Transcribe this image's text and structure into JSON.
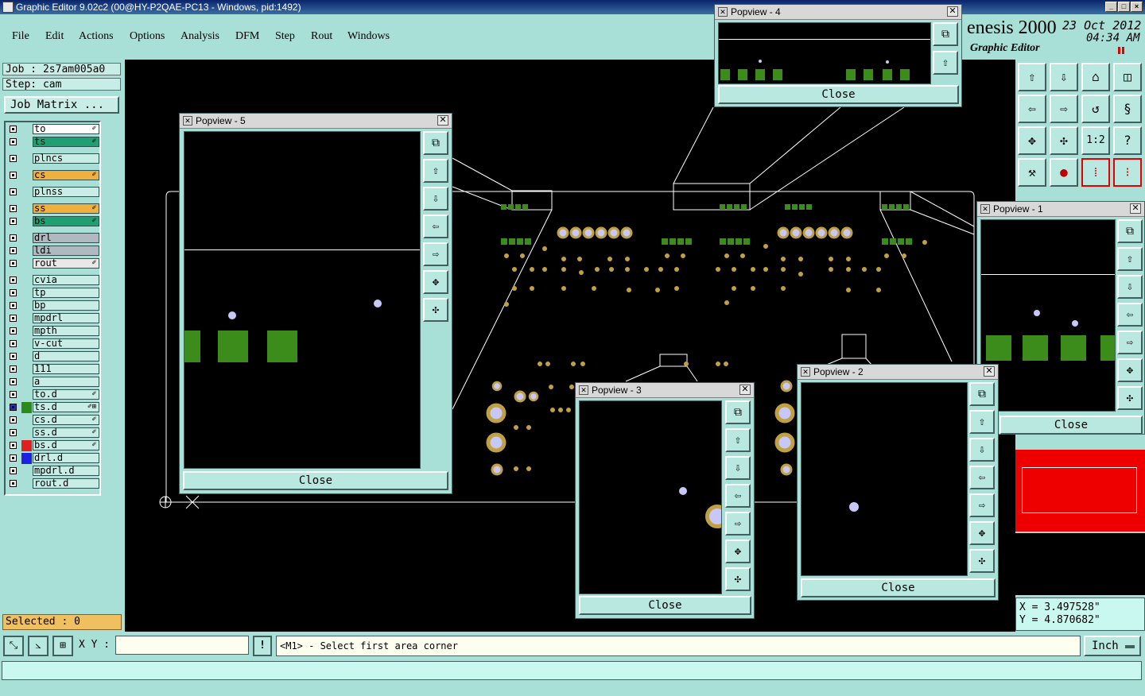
{
  "window": {
    "title": "Graphic Editor 9.02c2 (00@HY-P2QAE-PC13 - Windows, pid:1492)"
  },
  "menu": [
    "File",
    "Edit",
    "Actions",
    "Options",
    "Analysis",
    "DFM",
    "Step",
    "Rout",
    "Windows"
  ],
  "logo": {
    "brand": "enesis 2000",
    "subtitle": "Graphic Editor",
    "date": "23 Oct 2012",
    "time": "04:34 AM"
  },
  "job": {
    "job": "Job : 2s7am005a0",
    "step": "Step: cam",
    "matrix": "Job Matrix ..."
  },
  "layers": [
    {
      "name": "to",
      "color": "#ffffff",
      "mark": "✐"
    },
    {
      "name": "ts",
      "color": "#20a070",
      "mark": "✐"
    },
    {
      "name": "plncs",
      "color": "#c8ece6",
      "mark": ""
    },
    {
      "name": "cs",
      "color": "#f0b040",
      "mark": "✐"
    },
    {
      "name": "plnss",
      "color": "#c8ece6",
      "mark": ""
    },
    {
      "name": "ss",
      "color": "#f0b040",
      "mark": "✐"
    },
    {
      "name": "bs",
      "color": "#20a070",
      "mark": "✐"
    },
    {
      "name": "drl",
      "color": "#b0b8c0",
      "mark": ""
    },
    {
      "name": "ldi",
      "color": "#b0b8c0",
      "mark": ""
    },
    {
      "name": "rout",
      "color": "#e8e8e8",
      "mark": "✐"
    },
    {
      "name": "cvia",
      "color": "#c8ece6",
      "mark": ""
    },
    {
      "name": "tp",
      "color": "#c8ece6",
      "mark": ""
    },
    {
      "name": "bp",
      "color": "#c8ece6",
      "mark": ""
    },
    {
      "name": "mpdrl",
      "color": "#c8ece6",
      "mark": ""
    },
    {
      "name": "mpth",
      "color": "#c8ece6",
      "mark": ""
    },
    {
      "name": "v-cut",
      "color": "#c8ece6",
      "mark": ""
    },
    {
      "name": "d",
      "color": "#c8ece6",
      "mark": ""
    },
    {
      "name": "111",
      "color": "#c8ece6",
      "mark": ""
    },
    {
      "name": "a",
      "color": "#c8ece6",
      "mark": ""
    },
    {
      "name": "to.d",
      "color": "#c8ece6",
      "mark": "✐"
    },
    {
      "name": "ts.d",
      "color": "#c8ece6",
      "mark": "✐⊞",
      "swatch": "#2a8a1a",
      "active": true
    },
    {
      "name": "cs.d",
      "color": "#c8ece6",
      "mark": "✐"
    },
    {
      "name": "ss.d",
      "color": "#c8ece6",
      "mark": "✐"
    },
    {
      "name": "bs.d",
      "color": "#c8ece6",
      "mark": "✐",
      "swatch": "#e02020"
    },
    {
      "name": "drl.d",
      "color": "#c8ece6",
      "mark": "",
      "swatch": "#2020e0"
    },
    {
      "name": "mpdrl.d",
      "color": "#c8ece6",
      "mark": ""
    },
    {
      "name": "rout.d",
      "color": "#c8ece6",
      "mark": ""
    }
  ],
  "selected": "Selected : 0",
  "coords": {
    "x": "X = 3.497528\"",
    "y": "Y = 4.870682\""
  },
  "bottom": {
    "xy_label": "X Y :",
    "xy_value": "",
    "prompt": "<M1> - Select first area corner",
    "unit": "Inch",
    "bang": "!"
  },
  "popups": {
    "p1": {
      "title": "Popview - 1",
      "close": "Close"
    },
    "p2": {
      "title": "Popview - 2",
      "close": "Close"
    },
    "p3": {
      "title": "Popview - 3",
      "close": "Close"
    },
    "p4": {
      "title": "Popview - 4",
      "close": "Close"
    },
    "p5": {
      "title": "Popview - 5",
      "close": "Close"
    }
  },
  "rightbuttons": [
    "1:2",
    "?"
  ]
}
